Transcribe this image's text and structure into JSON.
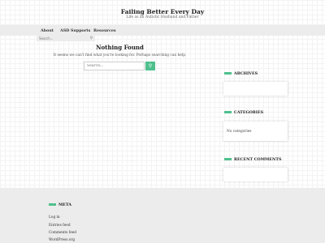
{
  "site": {
    "title": "Failing Better Every Day",
    "tagline": "Life as an Autistic Husband and Father"
  },
  "nav": {
    "items": [
      {
        "label": "About"
      },
      {
        "label": "ASD Supports"
      },
      {
        "label": "Resources"
      }
    ],
    "search_placeholder": "Search..."
  },
  "main": {
    "heading": "Nothing Found",
    "message": "It seems we can't find what you're looking for. Perhaps searching can help.",
    "search_placeholder": "Search..."
  },
  "sidebar": {
    "archives_title": "ARCHIVES",
    "categories_title": "CATEGORIES",
    "categories_text": "No categories",
    "recent_comments_title": "RECENT COMMENTS"
  },
  "footer": {
    "meta_title": "META",
    "links": [
      {
        "label": "Log in"
      },
      {
        "label": "Entries feed"
      },
      {
        "label": "Comments feed"
      },
      {
        "label": "WordPress.org"
      }
    ]
  },
  "colors": {
    "accent": "#4fc08d",
    "nav_bg": "#ececec",
    "footer_bg": "#ececec"
  }
}
